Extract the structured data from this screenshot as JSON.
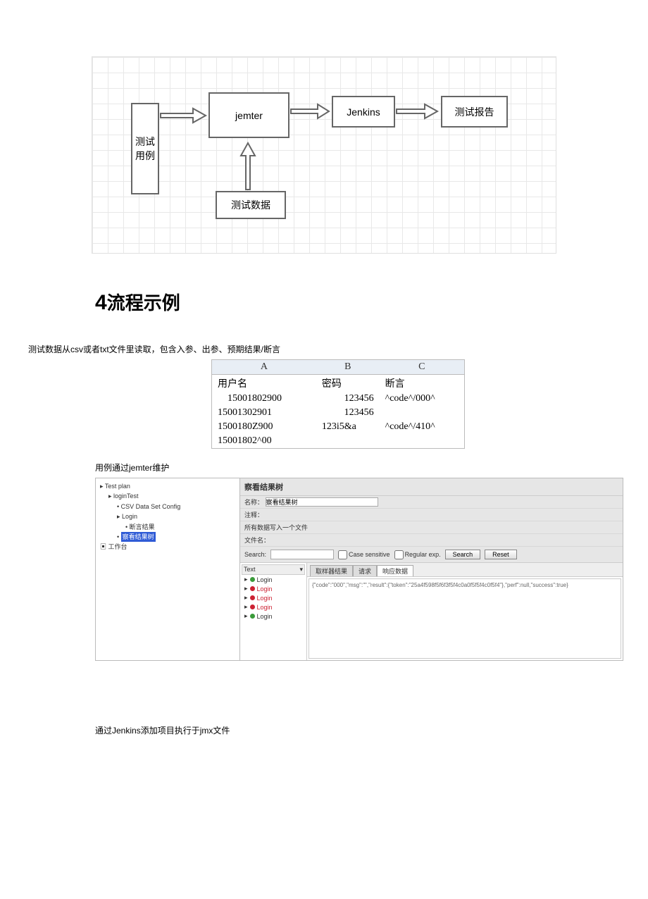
{
  "diagram": {
    "box_usecase": "测试\n用例",
    "box_jemter": "jemter",
    "box_jenkins": "Jenkins",
    "box_report": "测试报告",
    "box_data": "测试数据"
  },
  "heading": {
    "num": "4",
    "text": "流程示例"
  },
  "para_csv": "测试数据从csv或者txt文件里读取，包含入参、出参、预期结果/断言",
  "sheet": {
    "cols": [
      "A",
      "B",
      "C"
    ],
    "headers": [
      "用户名",
      "密码",
      "断言"
    ],
    "rows": [
      [
        "15001802900",
        "123456",
        "^code^/000^"
      ],
      [
        "15001302901",
        "123456",
        ""
      ],
      [
        "1500180Z900",
        "123i5&a",
        "^code^/410^"
      ],
      [
        "15001802^00",
        "",
        ""
      ]
    ]
  },
  "para_jmeter": "用例通过jemter维护",
  "jmeter": {
    "tree": {
      "n0": "Test plan",
      "n1": "loginTest",
      "n2": "CSV Data Set Config",
      "n3": "Login",
      "n4": "断言结果",
      "n5": "察看结果树",
      "n6": "工作台"
    },
    "panel_title": "察看结果树",
    "label_name": "名称：",
    "value_name": "察看结果树",
    "label_comment": "注释：",
    "label_writeto": "所有数据写入一个文件",
    "label_filename": "文件名：",
    "label_search": "Search:",
    "cb_case": "Case sensitive",
    "cb_regex": "Regular exp.",
    "btn_search": "Search",
    "btn_reset": "Reset",
    "col_text": "Text",
    "results": [
      "Login",
      "Login",
      "Login",
      "Login",
      "Login"
    ],
    "result_states": [
      "g",
      "r",
      "r",
      "r",
      "g"
    ],
    "tabs": [
      "取样器结果",
      "请求",
      "响应数据"
    ],
    "response_body": "{\"code\":\"000\",\"msg\":\"\",\"result\":{\"token\":\"25a4f598f5f6f3f5f4c0a0f5f5f4c0f5f4\"},\"perf\":null,\"success\":true}"
  },
  "para_jenkins": "通过Jenkins添加项目执行于jmx文件"
}
